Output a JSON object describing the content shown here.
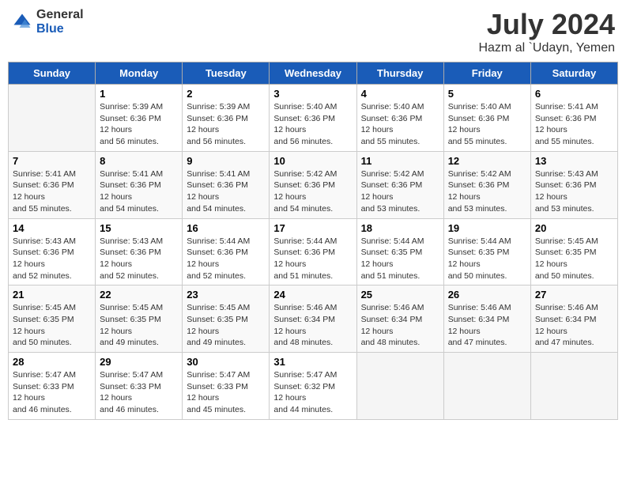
{
  "header": {
    "logo": {
      "general": "General",
      "blue": "Blue"
    },
    "month": "July 2024",
    "location": "Hazm al `Udayn, Yemen"
  },
  "days_of_week": [
    "Sunday",
    "Monday",
    "Tuesday",
    "Wednesday",
    "Thursday",
    "Friday",
    "Saturday"
  ],
  "weeks": [
    [
      {
        "day": "",
        "sunrise": "",
        "sunset": "",
        "daylight": ""
      },
      {
        "day": "1",
        "sunrise": "Sunrise: 5:39 AM",
        "sunset": "Sunset: 6:36 PM",
        "daylight": "Daylight: 12 hours and 56 minutes."
      },
      {
        "day": "2",
        "sunrise": "Sunrise: 5:39 AM",
        "sunset": "Sunset: 6:36 PM",
        "daylight": "Daylight: 12 hours and 56 minutes."
      },
      {
        "day": "3",
        "sunrise": "Sunrise: 5:40 AM",
        "sunset": "Sunset: 6:36 PM",
        "daylight": "Daylight: 12 hours and 56 minutes."
      },
      {
        "day": "4",
        "sunrise": "Sunrise: 5:40 AM",
        "sunset": "Sunset: 6:36 PM",
        "daylight": "Daylight: 12 hours and 55 minutes."
      },
      {
        "day": "5",
        "sunrise": "Sunrise: 5:40 AM",
        "sunset": "Sunset: 6:36 PM",
        "daylight": "Daylight: 12 hours and 55 minutes."
      },
      {
        "day": "6",
        "sunrise": "Sunrise: 5:41 AM",
        "sunset": "Sunset: 6:36 PM",
        "daylight": "Daylight: 12 hours and 55 minutes."
      }
    ],
    [
      {
        "day": "7",
        "sunrise": "Sunrise: 5:41 AM",
        "sunset": "Sunset: 6:36 PM",
        "daylight": "Daylight: 12 hours and 55 minutes."
      },
      {
        "day": "8",
        "sunrise": "Sunrise: 5:41 AM",
        "sunset": "Sunset: 6:36 PM",
        "daylight": "Daylight: 12 hours and 54 minutes."
      },
      {
        "day": "9",
        "sunrise": "Sunrise: 5:41 AM",
        "sunset": "Sunset: 6:36 PM",
        "daylight": "Daylight: 12 hours and 54 minutes."
      },
      {
        "day": "10",
        "sunrise": "Sunrise: 5:42 AM",
        "sunset": "Sunset: 6:36 PM",
        "daylight": "Daylight: 12 hours and 54 minutes."
      },
      {
        "day": "11",
        "sunrise": "Sunrise: 5:42 AM",
        "sunset": "Sunset: 6:36 PM",
        "daylight": "Daylight: 12 hours and 53 minutes."
      },
      {
        "day": "12",
        "sunrise": "Sunrise: 5:42 AM",
        "sunset": "Sunset: 6:36 PM",
        "daylight": "Daylight: 12 hours and 53 minutes."
      },
      {
        "day": "13",
        "sunrise": "Sunrise: 5:43 AM",
        "sunset": "Sunset: 6:36 PM",
        "daylight": "Daylight: 12 hours and 53 minutes."
      }
    ],
    [
      {
        "day": "14",
        "sunrise": "Sunrise: 5:43 AM",
        "sunset": "Sunset: 6:36 PM",
        "daylight": "Daylight: 12 hours and 52 minutes."
      },
      {
        "day": "15",
        "sunrise": "Sunrise: 5:43 AM",
        "sunset": "Sunset: 6:36 PM",
        "daylight": "Daylight: 12 hours and 52 minutes."
      },
      {
        "day": "16",
        "sunrise": "Sunrise: 5:44 AM",
        "sunset": "Sunset: 6:36 PM",
        "daylight": "Daylight: 12 hours and 52 minutes."
      },
      {
        "day": "17",
        "sunrise": "Sunrise: 5:44 AM",
        "sunset": "Sunset: 6:36 PM",
        "daylight": "Daylight: 12 hours and 51 minutes."
      },
      {
        "day": "18",
        "sunrise": "Sunrise: 5:44 AM",
        "sunset": "Sunset: 6:35 PM",
        "daylight": "Daylight: 12 hours and 51 minutes."
      },
      {
        "day": "19",
        "sunrise": "Sunrise: 5:44 AM",
        "sunset": "Sunset: 6:35 PM",
        "daylight": "Daylight: 12 hours and 50 minutes."
      },
      {
        "day": "20",
        "sunrise": "Sunrise: 5:45 AM",
        "sunset": "Sunset: 6:35 PM",
        "daylight": "Daylight: 12 hours and 50 minutes."
      }
    ],
    [
      {
        "day": "21",
        "sunrise": "Sunrise: 5:45 AM",
        "sunset": "Sunset: 6:35 PM",
        "daylight": "Daylight: 12 hours and 50 minutes."
      },
      {
        "day": "22",
        "sunrise": "Sunrise: 5:45 AM",
        "sunset": "Sunset: 6:35 PM",
        "daylight": "Daylight: 12 hours and 49 minutes."
      },
      {
        "day": "23",
        "sunrise": "Sunrise: 5:45 AM",
        "sunset": "Sunset: 6:35 PM",
        "daylight": "Daylight: 12 hours and 49 minutes."
      },
      {
        "day": "24",
        "sunrise": "Sunrise: 5:46 AM",
        "sunset": "Sunset: 6:34 PM",
        "daylight": "Daylight: 12 hours and 48 minutes."
      },
      {
        "day": "25",
        "sunrise": "Sunrise: 5:46 AM",
        "sunset": "Sunset: 6:34 PM",
        "daylight": "Daylight: 12 hours and 48 minutes."
      },
      {
        "day": "26",
        "sunrise": "Sunrise: 5:46 AM",
        "sunset": "Sunset: 6:34 PM",
        "daylight": "Daylight: 12 hours and 47 minutes."
      },
      {
        "day": "27",
        "sunrise": "Sunrise: 5:46 AM",
        "sunset": "Sunset: 6:34 PM",
        "daylight": "Daylight: 12 hours and 47 minutes."
      }
    ],
    [
      {
        "day": "28",
        "sunrise": "Sunrise: 5:47 AM",
        "sunset": "Sunset: 6:33 PM",
        "daylight": "Daylight: 12 hours and 46 minutes."
      },
      {
        "day": "29",
        "sunrise": "Sunrise: 5:47 AM",
        "sunset": "Sunset: 6:33 PM",
        "daylight": "Daylight: 12 hours and 46 minutes."
      },
      {
        "day": "30",
        "sunrise": "Sunrise: 5:47 AM",
        "sunset": "Sunset: 6:33 PM",
        "daylight": "Daylight: 12 hours and 45 minutes."
      },
      {
        "day": "31",
        "sunrise": "Sunrise: 5:47 AM",
        "sunset": "Sunset: 6:32 PM",
        "daylight": "Daylight: 12 hours and 44 minutes."
      },
      {
        "day": "",
        "sunrise": "",
        "sunset": "",
        "daylight": ""
      },
      {
        "day": "",
        "sunrise": "",
        "sunset": "",
        "daylight": ""
      },
      {
        "day": "",
        "sunrise": "",
        "sunset": "",
        "daylight": ""
      }
    ]
  ]
}
